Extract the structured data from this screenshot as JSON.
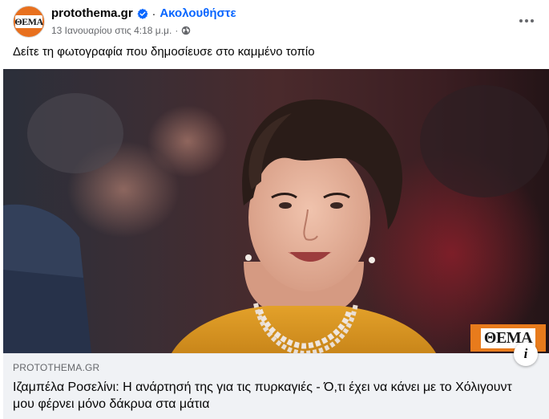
{
  "header": {
    "page_name": "protothema.gr",
    "separator": "·",
    "follow_label": "Ακολουθήστε",
    "timestamp": "13 Ιανουαρίου στις 4:18 μ.μ.",
    "meta_separator": "·",
    "avatar_text": "ΘΕΜΑ",
    "verified_icon": "verified-badge-icon",
    "privacy_icon": "globe-icon"
  },
  "post": {
    "text": "Δείτε τη φωτογραφία που δημοσίευσε στο καμμένο τοπίο",
    "photo_logo_text": "ΘΕΜΑ"
  },
  "link_preview": {
    "domain": "PROTOTHEMA.GR",
    "title": "Ιζαμπέλα Ροσελίνι: Η ανάρτησή της για τις πυρκαγιές - Ό,τι έχει να κάνει με το Χόλιγουντ μου φέρνει μόνο δάκρυα στα μάτια",
    "info_glyph": "i"
  },
  "colors": {
    "accent": "#0866ff",
    "secondary_text": "#65676b",
    "brand_orange": "#e87b1c",
    "link_bg": "#f0f2f5"
  }
}
